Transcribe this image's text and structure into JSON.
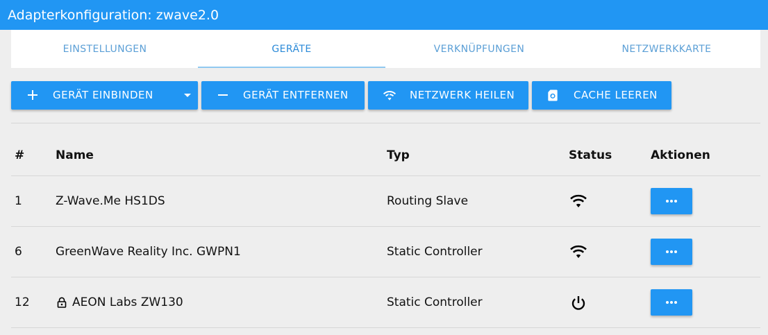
{
  "window": {
    "title": "Adapterkonfiguration: zwave2.0"
  },
  "tabs": [
    {
      "label": "EINSTELLUNGEN"
    },
    {
      "label": "GERÄTE"
    },
    {
      "label": "VERKNÜPFUNGEN"
    },
    {
      "label": "NETZWERKKARTE"
    }
  ],
  "active_tab": "GERÄTE",
  "toolbar": {
    "include_label": "GERÄT EINBINDEN",
    "remove_label": "GERÄT ENTFERNEN",
    "heal_label": "NETZWERK HEILEN",
    "cache_label": "CACHE LEEREN"
  },
  "table": {
    "headers": [
      "#",
      "Name",
      "Typ",
      "Status",
      "Aktionen"
    ],
    "rows": [
      {
        "id": "1",
        "name": "Z-Wave.Me HS1DS",
        "type": "Routing Slave",
        "status_icon": "wifi-icon",
        "secure": false
      },
      {
        "id": "6",
        "name": "GreenWave Reality Inc. GWPN1",
        "type": "Static Controller",
        "status_icon": "wifi-icon",
        "secure": false
      },
      {
        "id": "12",
        "name": "AEON Labs ZW130",
        "type": "Static Controller",
        "status_icon": "power-icon",
        "secure": true
      }
    ]
  },
  "colors": {
    "primary": "#2196f3",
    "background": "#eeeeee"
  }
}
